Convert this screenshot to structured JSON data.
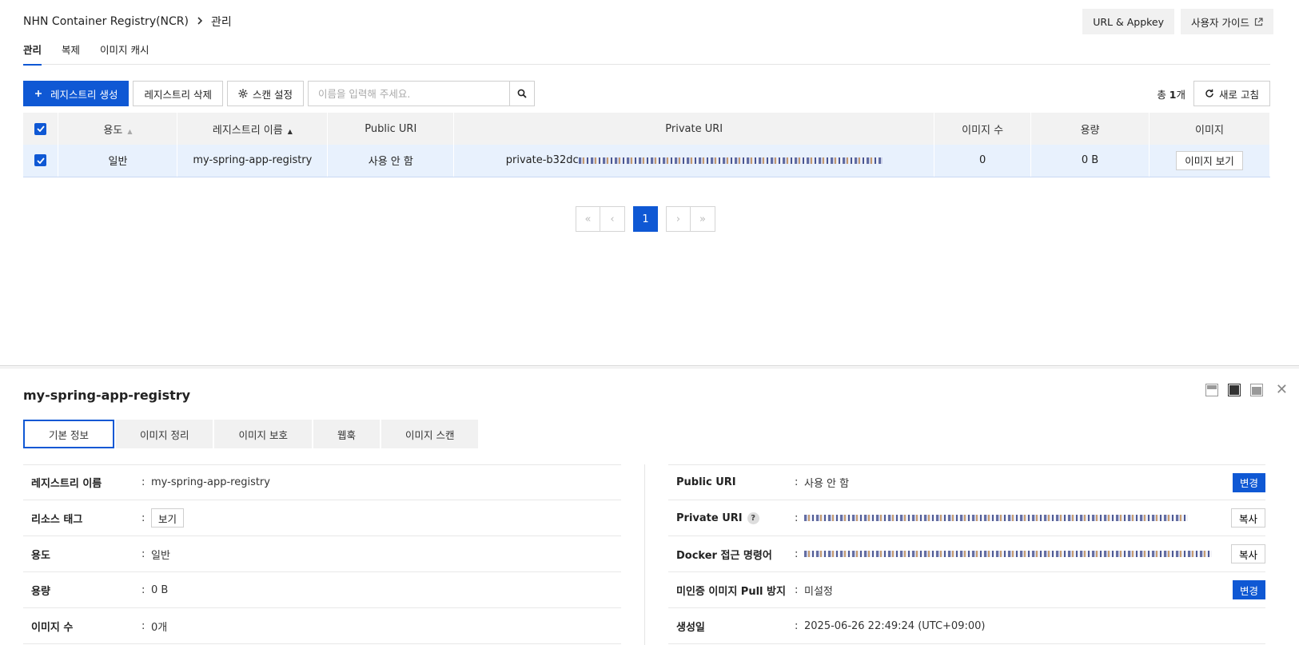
{
  "header": {
    "breadcrumb_root": "NHN Container Registry(NCR)",
    "breadcrumb_current": "관리",
    "url_appkey_label": "URL & Appkey",
    "user_guide_label": "사용자 가이드"
  },
  "tabs": [
    {
      "label": "관리"
    },
    {
      "label": "복제"
    },
    {
      "label": "이미지 캐시"
    }
  ],
  "toolbar": {
    "create_label": "레지스트리 생성",
    "delete_label": "레지스트리 삭제",
    "scan_label": "스캔 설정",
    "search_placeholder": "이름을 입력해 주세요.",
    "total_prefix": "총 ",
    "total_count": "1",
    "total_suffix": "개",
    "refresh_label": "새로 고침"
  },
  "table": {
    "columns": [
      "용도",
      "레지스트리 이름",
      "Public URI",
      "Private URI",
      "이미지 수",
      "용량",
      "이미지"
    ],
    "rows": [
      {
        "usage": "일반",
        "name": "my-spring-app-registry",
        "public_uri": "사용 안 함",
        "private_uri_prefix": "private-b32dc",
        "image_count": "0",
        "size": "0 B",
        "view_images_label": "이미지 보기"
      }
    ]
  },
  "pagination": {
    "current": "1",
    "first": "«",
    "prev": "‹",
    "next": "›",
    "last": "»"
  },
  "detail": {
    "title": "my-spring-app-registry",
    "tabs": [
      {
        "label": "기본 정보"
      },
      {
        "label": "이미지 정리"
      },
      {
        "label": "이미지 보호"
      },
      {
        "label": "웹훅"
      },
      {
        "label": "이미지 스캔"
      }
    ],
    "left": {
      "name_label": "레지스트리 이름",
      "name_value": "my-spring-app-registry",
      "tag_label": "리소스 태그",
      "tag_button": "보기",
      "usage_label": "용도",
      "usage_value": "일반",
      "size_label": "용량",
      "size_value": "0 B",
      "image_count_label": "이미지 수",
      "image_count_value": "0개"
    },
    "right": {
      "public_uri_label": "Public URI",
      "public_uri_value": "사용 안 함",
      "change_label": "변경",
      "private_uri_label": "Private URI",
      "copy_label": "복사",
      "docker_label": "Docker 접근 명령어",
      "unauth_label": "미인증 이미지 Pull 방지",
      "unauth_value": "미설정",
      "created_label": "생성일",
      "created_value": "2025-06-26 22:49:24 (UTC+09:00)"
    }
  },
  "colors": {
    "primary": "#0f58d4",
    "row_selected": "#e8f1fd",
    "header_bg": "#f2f2f2"
  }
}
